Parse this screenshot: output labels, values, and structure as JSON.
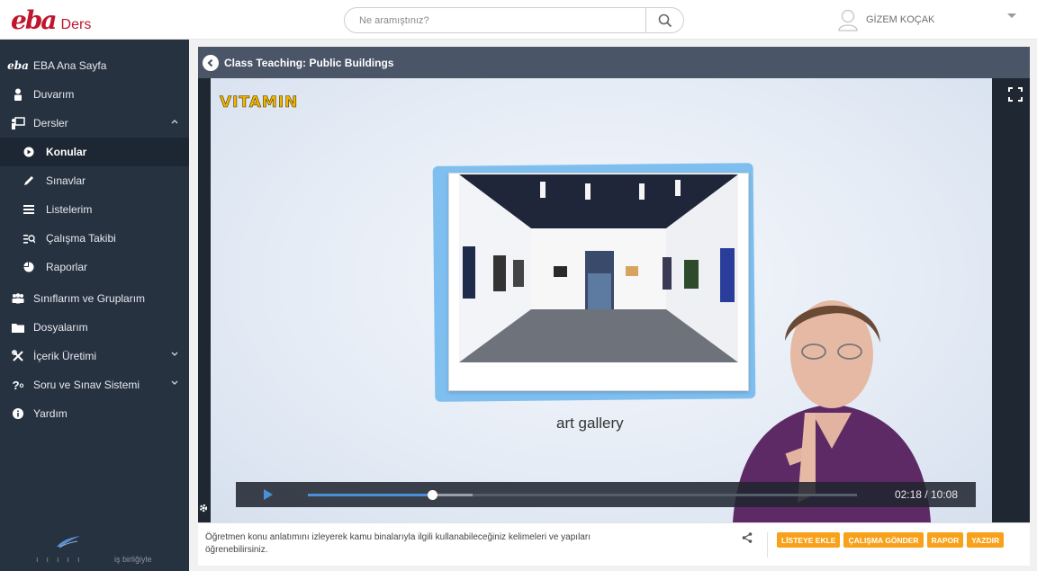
{
  "header": {
    "logo_mark": "eba",
    "logo_text": "Ders",
    "search_placeholder": "Ne aramıştınız?",
    "user_name": "GİZEM KOÇAK"
  },
  "sidebar": {
    "items": [
      {
        "label": "EBA Ana Sayfa",
        "icon": "eba-icon"
      },
      {
        "label": "Duvarım",
        "icon": "person-icon"
      },
      {
        "label": "Dersler",
        "icon": "teacher-board-icon",
        "expanded": true
      },
      {
        "label": "Konular",
        "icon": "play-circle-icon",
        "active": true
      },
      {
        "label": "Sınavlar",
        "icon": "pencil-icon"
      },
      {
        "label": "Listelerim",
        "icon": "list-icon"
      },
      {
        "label": "Çalışma Takibi",
        "icon": "tracking-icon"
      },
      {
        "label": "Raporlar",
        "icon": "pie-chart-icon"
      },
      {
        "label": "Sınıflarım ve Gruplarım",
        "icon": "group-icon"
      },
      {
        "label": "Dosyalarım",
        "icon": "folder-icon"
      },
      {
        "label": "İçerik Üretimi",
        "icon": "tools-icon",
        "expanded": false
      },
      {
        "label": "Soru ve Sınav Sistemi",
        "icon": "question-icon",
        "expanded": false
      },
      {
        "label": "Yardım",
        "icon": "info-icon"
      }
    ],
    "partner_text": "iş birliğiyle"
  },
  "content": {
    "title": "Class Teaching: Public Buildings",
    "video": {
      "brand": "VITAMIN",
      "caption": "art gallery",
      "current_time": "02:18",
      "duration": "10:08",
      "time_display": "02:18 / 10:08",
      "progress_fraction": 0.227,
      "buffered_fraction": 0.3
    },
    "description": "Öğretmen konu anlatımını izleyerek kamu binalarıyla ilgili kullanabileceğiniz kelimeleri ve yapıları öğrenebilirsiniz.",
    "actions": [
      "LİSTEYE EKLE",
      "ÇALIŞMA GÖNDER",
      "RAPOR",
      "YAZDIR"
    ]
  },
  "colors": {
    "brand_red": "#c0152d",
    "sidebar_bg": "#273241",
    "action_orange": "#f7a21a",
    "progress_blue": "#4a90d9"
  }
}
